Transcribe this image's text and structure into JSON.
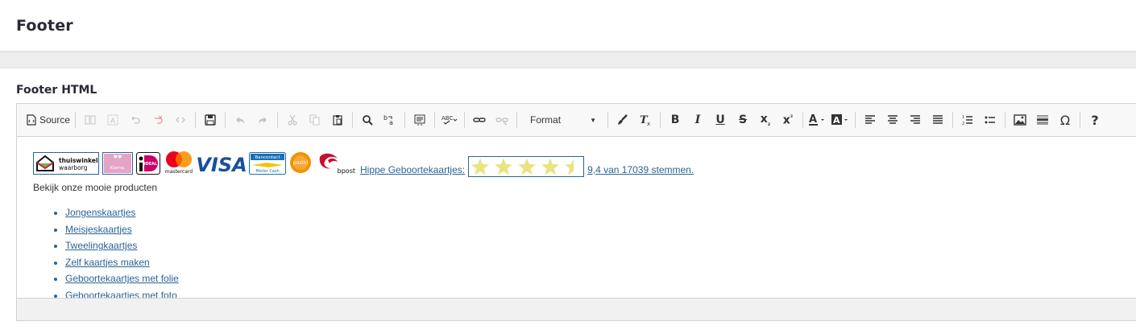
{
  "header": {
    "title": "Footer"
  },
  "section": {
    "label": "Footer HTML"
  },
  "toolbar": {
    "source_label": "Source",
    "format_label": "Format",
    "colors": {
      "icon": "#333333",
      "disabled": "#c4c4c4"
    }
  },
  "content": {
    "logos": {
      "thuiswinkel_line1": "thuiswinkel",
      "thuiswinkel_line2": "waarborg",
      "klarna": "Klarna.",
      "ideal": "iDEAL",
      "mastercard": "mastercard",
      "visa": "VISA",
      "bancontact_line1": "Bancontact",
      "bancontact_line2": "Mister Cash",
      "postnl": "postnl",
      "bpost": "bpost"
    },
    "rating_link_prefix": "Hippe Geboortekaartjes:",
    "rating_value": 4.5,
    "rating_max": 5,
    "rating_text": "9,4 van 17039 stemmen.",
    "intro": "Bekijk onze mooie producten",
    "products": [
      "Jongenskaartjes",
      "Meisjeskaartjes",
      "Tweelingkaartjes",
      "Zelf kaartjes maken",
      "Geboortekaartjes met folie",
      "Geboortekaartjes met foto"
    ]
  },
  "colors": {
    "link": "#2a6496",
    "star": "#e8e480",
    "accent_border": "#2a6496"
  }
}
